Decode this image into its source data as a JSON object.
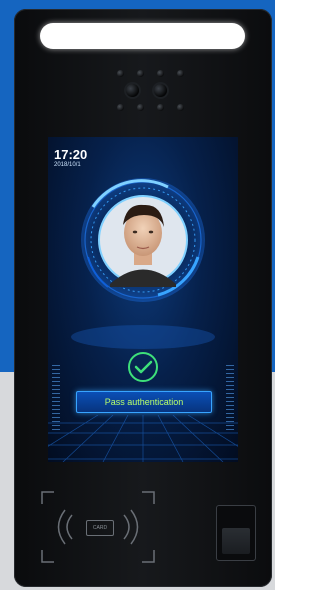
{
  "screen": {
    "time": "17:20",
    "date": "2018/10/1",
    "status_text": "Pass authentication",
    "accent_color": "#38a4ff",
    "success_color": "#3ee07a"
  },
  "card_reader": {
    "label": "CARD"
  },
  "icons": {
    "success": "check-circle-icon",
    "card": "contactless-card-icon",
    "fingerprint": "fingerprint-sensor-icon"
  }
}
